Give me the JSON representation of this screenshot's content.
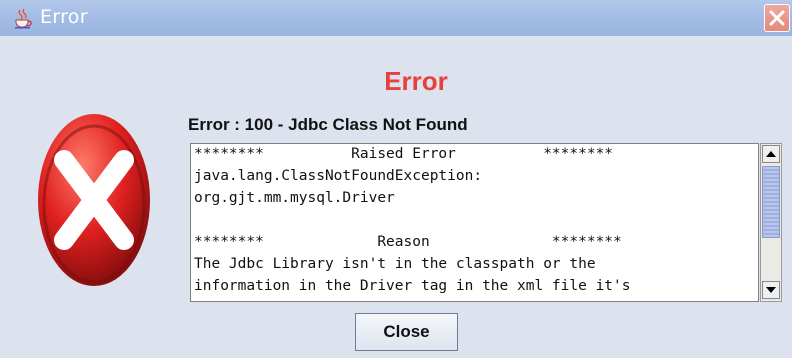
{
  "window": {
    "title": "Error"
  },
  "dialog": {
    "heading": "Error",
    "message": "Error : 100 - Jdbc Class Not Found",
    "details_lines": [
      "********          Raised Error          ********",
      "java.lang.ClassNotFoundException:",
      "org.gjt.mm.mysql.Driver",
      "",
      "********             Reason              ********",
      "The Jdbc Library isn't in the classpath or the",
      "information in the Driver tag in the xml file it's"
    ],
    "close_label": "Close"
  },
  "colors": {
    "titlebar": "#a4bde6",
    "heading": "#e8413c",
    "background": "#dde3ee",
    "error_icon": "#e02020"
  },
  "icons": {
    "window_icon": "java-cup-icon",
    "error_icon": "error-x-icon",
    "close_window": "close-icon",
    "scroll_up": "arrow-up-icon",
    "scroll_down": "arrow-down-icon"
  }
}
